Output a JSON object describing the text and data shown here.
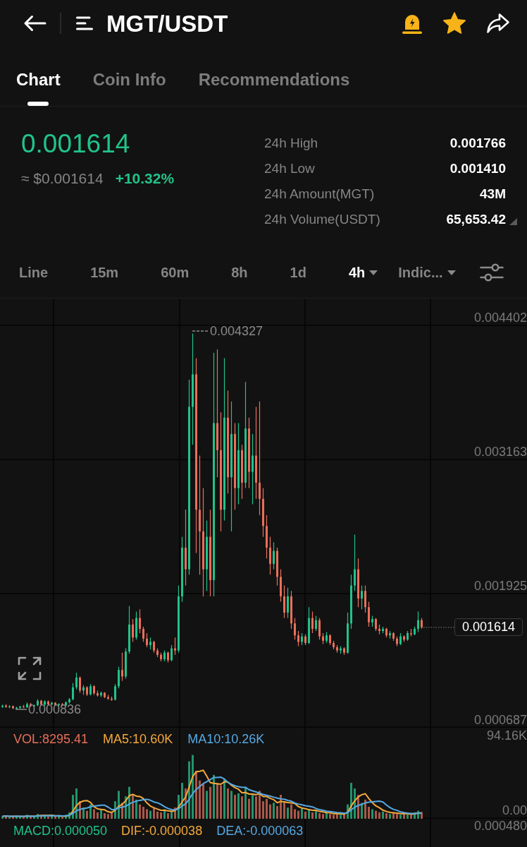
{
  "header": {
    "title": "MGT/USDT"
  },
  "tabs": [
    {
      "label": "Chart",
      "selected": true
    },
    {
      "label": "Coin Info",
      "selected": false
    },
    {
      "label": "Recommendations",
      "selected": false
    }
  ],
  "ticker": {
    "last_price": "0.001614",
    "usd_price": "≈ $0.001614",
    "change": "+10.32%"
  },
  "stats": [
    {
      "label": "24h High",
      "value": "0.001766"
    },
    {
      "label": "24h Low",
      "value": "0.001410"
    },
    {
      "label": "24h Amount(MGT)",
      "value": "43M"
    },
    {
      "label": "24h Volume(USDT)",
      "value": "65,653.42"
    }
  ],
  "intervals": [
    {
      "label": "Line",
      "selected": false,
      "dropdown": false
    },
    {
      "label": "15m",
      "selected": false,
      "dropdown": false
    },
    {
      "label": "60m",
      "selected": false,
      "dropdown": false
    },
    {
      "label": "8h",
      "selected": false,
      "dropdown": false
    },
    {
      "label": "1d",
      "selected": false,
      "dropdown": false
    },
    {
      "label": "4h",
      "selected": true,
      "dropdown": true
    }
  ],
  "indicator_menu": {
    "label": "Indic..."
  },
  "chart": {
    "chart_data": {
      "type": "candlestick",
      "grid": true,
      "ylim": [
        0.000687,
        0.00465
      ],
      "yticks": [
        {
          "value": 0.004402,
          "label": "0.004402"
        },
        {
          "value": 0.003163,
          "label": "0.003163"
        },
        {
          "value": 0.001925,
          "label": "0.001925"
        },
        {
          "value": 0.000687,
          "label": "0.000687"
        }
      ],
      "categories": [
        null,
        null,
        null,
        null,
        null,
        null,
        null,
        null,
        null,
        null,
        null,
        null,
        null,
        null,
        null,
        null,
        null,
        null,
        null,
        null,
        null,
        null,
        null,
        null,
        null,
        null,
        null,
        null,
        null,
        null,
        null,
        null,
        null,
        null,
        null,
        null,
        null,
        null,
        null,
        null,
        null,
        null,
        null,
        null,
        null,
        null,
        null,
        null,
        null,
        null,
        null,
        null,
        null,
        null,
        null,
        null,
        null,
        null,
        null,
        null,
        null,
        null,
        null,
        null,
        null,
        null,
        null,
        null,
        null,
        null,
        null,
        null,
        null,
        null,
        null,
        null,
        null,
        null,
        null,
        null,
        null,
        null,
        null,
        null,
        null,
        null,
        null,
        null,
        null,
        null,
        null,
        null,
        null,
        null,
        null,
        null,
        null,
        null,
        null,
        null,
        null,
        null,
        null,
        null,
        null,
        null,
        null,
        null,
        null,
        null,
        null,
        null,
        null,
        null,
        null,
        null,
        null,
        null,
        null,
        null
      ],
      "ohlc": [
        [
          0.00088,
          0.0009,
          0.00087,
          0.00089
        ],
        [
          0.00089,
          0.000905,
          0.000872,
          0.000878
        ],
        [
          0.000878,
          0.000895,
          0.000868,
          0.000885
        ],
        [
          0.000885,
          0.000892,
          0.00086,
          0.000866
        ],
        [
          0.000866,
          0.00088,
          0.000855,
          0.000872
        ],
        [
          0.000872,
          0.00089,
          0.000862,
          0.000882
        ],
        [
          0.000882,
          0.000898,
          0.00087,
          0.000875
        ],
        [
          0.000875,
          0.00092,
          0.00087,
          0.000905
        ],
        [
          0.000905,
          0.000915,
          0.00088,
          0.000888
        ],
        [
          0.000888,
          0.0009,
          0.000875,
          0.000895
        ],
        [
          0.000895,
          0.00095,
          0.000885,
          0.000935
        ],
        [
          0.000935,
          0.000945,
          0.00089,
          0.0009
        ],
        [
          0.0009,
          0.00094,
          0.00089,
          0.00093
        ],
        [
          0.00093,
          0.000938,
          0.000892,
          0.000902
        ],
        [
          0.000902,
          0.000925,
          0.000895,
          0.000918
        ],
        [
          0.000918,
          0.000922,
          0.00089,
          0.000896
        ],
        [
          0.000896,
          0.000912,
          0.000885,
          0.000905
        ],
        [
          0.000905,
          0.000915,
          0.000888,
          0.000893
        ],
        [
          0.000893,
          0.00093,
          0.000885,
          0.000922
        ],
        [
          0.000922,
          0.00096,
          0.00091,
          0.00095
        ],
        [
          0.00095,
          0.0011,
          0.00094,
          0.00106
        ],
        [
          0.00106,
          0.001195,
          0.00104,
          0.00115
        ],
        [
          0.00115,
          0.00116,
          0.00101,
          0.00103
        ],
        [
          0.00103,
          0.00108,
          0.00099,
          0.00106
        ],
        [
          0.00106,
          0.00107,
          0.00098,
          0.000995
        ],
        [
          0.000995,
          0.00109,
          0.000985,
          0.00107
        ],
        [
          0.00107,
          0.00108,
          0.00099,
          0.001005
        ],
        [
          0.001005,
          0.00103,
          0.000975,
          0.000985
        ],
        [
          0.000985,
          0.00102,
          0.00097,
          0.00101
        ],
        [
          0.00101,
          0.001015,
          0.00096,
          0.00097
        ],
        [
          0.00097,
          0.00099,
          0.000945,
          0.000955
        ],
        [
          0.000955,
          0.000975,
          0.000935,
          0.000945
        ],
        [
          0.000945,
          0.00109,
          0.00094,
          0.00107
        ],
        [
          0.00107,
          0.00125,
          0.00105,
          0.00122
        ],
        [
          0.00122,
          0.00138,
          0.00112,
          0.00116
        ],
        [
          0.00116,
          0.00142,
          0.00114,
          0.00139
        ],
        [
          0.00139,
          0.00181,
          0.00137,
          0.00164
        ],
        [
          0.00164,
          0.00169,
          0.00148,
          0.00152
        ],
        [
          0.00152,
          0.00176,
          0.0015,
          0.0017
        ],
        [
          0.0017,
          0.00178,
          0.00156,
          0.0016
        ],
        [
          0.0016,
          0.00162,
          0.00148,
          0.00151
        ],
        [
          0.00151,
          0.00156,
          0.00143,
          0.00145
        ],
        [
          0.00145,
          0.00152,
          0.00141,
          0.00148
        ],
        [
          0.00148,
          0.00149,
          0.00138,
          0.0014
        ],
        [
          0.0014,
          0.00142,
          0.00134,
          0.00136
        ],
        [
          0.00136,
          0.00138,
          0.0013,
          0.00132
        ],
        [
          0.00132,
          0.0014,
          0.0013,
          0.00138
        ],
        [
          0.00138,
          0.00139,
          0.00129,
          0.00131
        ],
        [
          0.00131,
          0.00145,
          0.0013,
          0.00142
        ],
        [
          0.00142,
          0.00152,
          0.00136,
          0.0014
        ],
        [
          0.0014,
          0.002,
          0.00138,
          0.0019
        ],
        [
          0.0019,
          0.00245,
          0.00185,
          0.00235
        ],
        [
          0.00235,
          0.0027,
          0.002,
          0.00215
        ],
        [
          0.00215,
          0.0039,
          0.0021,
          0.00365
        ],
        [
          0.00365,
          0.004327,
          0.0033,
          0.00395
        ],
        [
          0.00395,
          0.0041,
          0.0023,
          0.0027
        ],
        [
          0.0027,
          0.0032,
          0.0021,
          0.0025
        ],
        [
          0.0025,
          0.0029,
          0.0019,
          0.00215
        ],
        [
          0.00215,
          0.0026,
          0.00195,
          0.00245
        ],
        [
          0.00245,
          0.0027,
          0.0019,
          0.00205
        ],
        [
          0.00205,
          0.00415,
          0.0019,
          0.0035
        ],
        [
          0.0035,
          0.00418,
          0.003,
          0.00325
        ],
        [
          0.00325,
          0.0036,
          0.0025,
          0.0027
        ],
        [
          0.0027,
          0.0041,
          0.0026,
          0.00355
        ],
        [
          0.00355,
          0.0038,
          0.00285,
          0.003
        ],
        [
          0.003,
          0.0037,
          0.0025,
          0.0034
        ],
        [
          0.0034,
          0.0035,
          0.0027,
          0.0029
        ],
        [
          0.0029,
          0.0035,
          0.00275,
          0.00325
        ],
        [
          0.00325,
          0.0033,
          0.0028,
          0.00295
        ],
        [
          0.00295,
          0.00388,
          0.0029,
          0.00345
        ],
        [
          0.00345,
          0.00355,
          0.0029,
          0.00305
        ],
        [
          0.00305,
          0.0034,
          0.00275,
          0.0032
        ],
        [
          0.0032,
          0.00365,
          0.0028,
          0.00295
        ],
        [
          0.00295,
          0.0037,
          0.00265,
          0.0028
        ],
        [
          0.0028,
          0.0029,
          0.00245,
          0.00255
        ],
        [
          0.00255,
          0.00265,
          0.00225,
          0.00235
        ],
        [
          0.00235,
          0.00245,
          0.0021,
          0.0022
        ],
        [
          0.0022,
          0.0024,
          0.00215,
          0.00232
        ],
        [
          0.00232,
          0.00235,
          0.002,
          0.00208
        ],
        [
          0.00208,
          0.00215,
          0.00185,
          0.0019
        ],
        [
          0.0019,
          0.002,
          0.0017,
          0.00175
        ],
        [
          0.00175,
          0.00198,
          0.0017,
          0.0019
        ],
        [
          0.0019,
          0.00195,
          0.0016,
          0.00165
        ],
        [
          0.00165,
          0.0017,
          0.0015,
          0.00154
        ],
        [
          0.00154,
          0.00158,
          0.00144,
          0.00148
        ],
        [
          0.00148,
          0.00156,
          0.00145,
          0.00153
        ],
        [
          0.00153,
          0.00155,
          0.00145,
          0.00147
        ],
        [
          0.00147,
          0.0018,
          0.00146,
          0.0017
        ],
        [
          0.0017,
          0.00176,
          0.00156,
          0.0016
        ],
        [
          0.0016,
          0.00172,
          0.00158,
          0.00168
        ],
        [
          0.00168,
          0.0017,
          0.0015,
          0.00153
        ],
        [
          0.00153,
          0.00156,
          0.00146,
          0.00149
        ],
        [
          0.00149,
          0.00157,
          0.00147,
          0.00154
        ],
        [
          0.00154,
          0.00155,
          0.00145,
          0.00147
        ],
        [
          0.00147,
          0.00149,
          0.00141,
          0.00143
        ],
        [
          0.00143,
          0.00145,
          0.00138,
          0.0014
        ],
        [
          0.0014,
          0.00144,
          0.00137,
          0.00142
        ],
        [
          0.00142,
          0.00143,
          0.00136,
          0.00138
        ],
        [
          0.00138,
          0.00175,
          0.00137,
          0.00165
        ],
        [
          0.00165,
          0.0021,
          0.0016,
          0.002
        ],
        [
          0.002,
          0.00247,
          0.00195,
          0.00215
        ],
        [
          0.00215,
          0.00225,
          0.0018,
          0.00188
        ],
        [
          0.00188,
          0.002,
          0.00178,
          0.00195
        ],
        [
          0.00195,
          0.002,
          0.00175,
          0.0018
        ],
        [
          0.0018,
          0.00185,
          0.00162,
          0.00166
        ],
        [
          0.00166,
          0.00172,
          0.00162,
          0.00169
        ],
        [
          0.00169,
          0.0017,
          0.00158,
          0.0016
        ],
        [
          0.0016,
          0.00164,
          0.00155,
          0.00158
        ],
        [
          0.00158,
          0.00162,
          0.00156,
          0.0016
        ],
        [
          0.0016,
          0.00161,
          0.00152,
          0.00154
        ],
        [
          0.00154,
          0.00158,
          0.00151,
          0.00156
        ],
        [
          0.00156,
          0.00157,
          0.00149,
          0.00151
        ],
        [
          0.00151,
          0.00153,
          0.00144,
          0.00146
        ],
        [
          0.00146,
          0.00156,
          0.00145,
          0.00153
        ],
        [
          0.00153,
          0.00154,
          0.00148,
          0.0015
        ],
        [
          0.0015,
          0.00158,
          0.00149,
          0.00156
        ],
        [
          0.00156,
          0.0016,
          0.00153,
          0.00155
        ],
        [
          0.00155,
          0.00162,
          0.00154,
          0.0016
        ],
        [
          0.0016,
          0.00176,
          0.00157,
          0.00168
        ],
        [
          0.00168,
          0.0017,
          0.0016,
          0.001614
        ]
      ]
    },
    "high_label": "0.004327",
    "low_label": "0.000836",
    "current_price": "0.001614"
  },
  "volume": {
    "legend": [
      {
        "label": "VOL:8295.41",
        "color": "#e8705a"
      },
      {
        "label": "MA5:10.60K",
        "color": "#f5a93b"
      },
      {
        "label": "MA10:10.26K",
        "color": "#56a9e3"
      }
    ],
    "axis": [
      "94.16K",
      "0.00"
    ]
  },
  "macd": {
    "legend": [
      {
        "label": "MACD:0.000050",
        "color": "#20c38a"
      },
      {
        "label": "DIF:-0.000038",
        "color": "#f5a93b"
      },
      {
        "label": "DEA:-0.000063",
        "color": "#56a9e3"
      }
    ],
    "axis": [
      "0.000480"
    ]
  }
}
